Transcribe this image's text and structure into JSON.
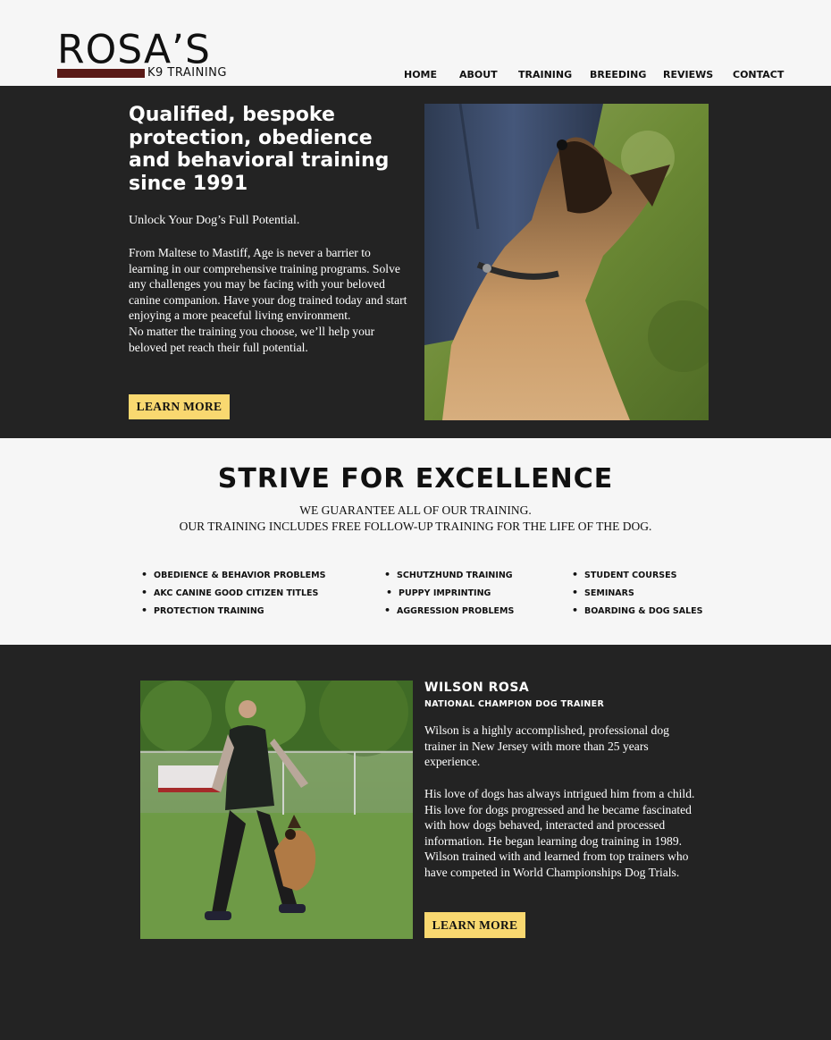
{
  "brand": {
    "name": "ROSA’S",
    "subtitle": "K9 TRAINING"
  },
  "nav": {
    "items": [
      "HOME",
      "ABOUT",
      "TRAINING",
      "BREEDING",
      "REVIEWS",
      "CONTACT"
    ]
  },
  "hero": {
    "heading": "Qualified, bespoke protection, obedience and behavioral training since 1991",
    "tagline": "Unlock Your Dog’s Full Potential.",
    "body_1": "From Maltese to Mastiff, Age is never a barrier to learning in our comprehensive training programs. Solve any challenges you may be facing with your beloved canine companion. Have your dog trained today and start enjoying a more peaceful living environment.",
    "body_2": "No matter the training you choose, we’ll help your beloved pet reach their full potential.",
    "button": "LEARN MORE"
  },
  "excellence": {
    "title": "STRIVE FOR EXCELLENCE",
    "line_1": "WE GUARANTEE ALL OF OUR TRAINING.",
    "line_2": "OUR TRAINING INCLUDES FREE FOLLOW-UP TRAINING FOR THE LIFE OF THE DOG.",
    "services": [
      [
        "OBEDIENCE & BEHAVIOR PROBLEMS",
        "AKC CANINE GOOD CITIZEN TITLES",
        "PROTECTION TRAINING"
      ],
      [
        "SCHUTZHUND TRAINING",
        "PUPPY IMPRINTING",
        "AGGRESSION PROBLEMS"
      ],
      [
        "STUDENT COURSES",
        "SEMINARS",
        "BOARDING & DOG SALES"
      ]
    ]
  },
  "trainer": {
    "name": "WILSON ROSA",
    "title": "NATIONAL CHAMPION DOG TRAINER",
    "para_1": "Wilson is a highly accomplished, professional dog trainer in New Jersey with more than 25 years experience.",
    "para_2": "His love of dogs has always intrigued him from a child. His love for dogs progressed and he became fascinated with how dogs behaved, interacted and processed information. He began learning dog training in 1989. Wilson trained with and learned from top trainers who have competed in World Championships Dog Trials.",
    "button": "LEARN MORE"
  },
  "colors": {
    "dark_bg": "#232323",
    "light_bg": "#f6f6f6",
    "button": "#f9d870",
    "brand_bar": "#5a1a17"
  }
}
